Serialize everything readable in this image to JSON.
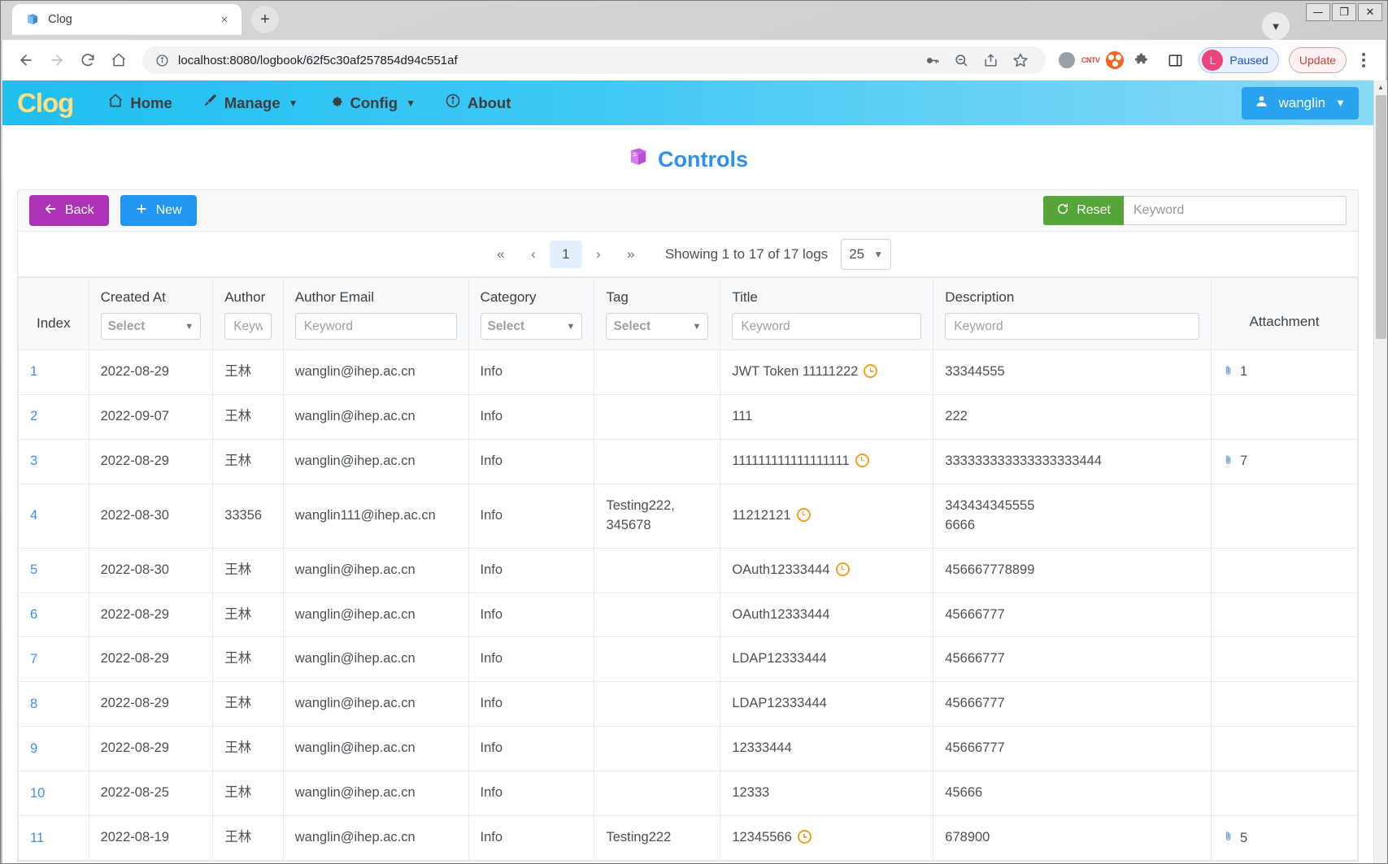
{
  "browser": {
    "tab": {
      "title": "Clog",
      "favicon_icon": "book-icon",
      "close_icon": "×"
    },
    "new_tab_label": "+",
    "tabstrip_caret_icon": "chevron-down-icon",
    "window_controls": {
      "minimize": "—",
      "maximize": "❐",
      "close": "✕"
    },
    "nav": {
      "back_icon": "arrow-left-icon",
      "forward_icon": "arrow-right-icon",
      "reload_icon": "reload-icon",
      "home_icon": "home-icon"
    },
    "omnibox": {
      "info_icon": "info-circle-icon",
      "url": "localhost:8080/logbook/62f5c30af257854d94c551af",
      "actions": [
        "key-icon",
        "zoom-out-icon",
        "share-icon",
        "star-icon"
      ]
    },
    "extensions": [
      "grey-balloon-icon",
      "cntv-icon",
      "orange-ubuntu-icon",
      "puzzle-icon",
      "sidepanel-icon"
    ],
    "profile": {
      "initial": "L",
      "label": "Paused"
    },
    "update_label": "Update",
    "menu_icon": "kebab-menu-icon"
  },
  "app": {
    "brand": "Clog",
    "nav_items": [
      {
        "label": "Home",
        "icon": "home-icon",
        "caret": false
      },
      {
        "label": "Manage",
        "icon": "brush-icon",
        "caret": true
      },
      {
        "label": "Config",
        "icon": "gear-icon",
        "caret": true
      },
      {
        "label": "About",
        "icon": "info-icon",
        "caret": false
      }
    ],
    "user": {
      "name": "wanglin",
      "icon": "user-icon",
      "caret_icon": "chevron-down-icon"
    },
    "page_title": {
      "text": "Controls",
      "icon": "book-icon"
    }
  },
  "toolbar": {
    "back_label": "Back",
    "back_icon": "arrow-left-icon",
    "new_label": "New",
    "new_icon": "plus-icon",
    "reset_label": "Reset",
    "reset_icon": "refresh-icon",
    "keyword_placeholder": "Keyword",
    "keyword_value": ""
  },
  "pager": {
    "first_label": "«",
    "prev_label": "‹",
    "pages": [
      "1"
    ],
    "current_page": "1",
    "next_label": "›",
    "last_label": "»",
    "info": "Showing 1 to 17 of 17 logs",
    "per_page": "25",
    "per_page_caret": "chevron-down-icon"
  },
  "table": {
    "columns": [
      {
        "key": "index",
        "label": "Index",
        "filter": null
      },
      {
        "key": "created_at",
        "label": "Created At",
        "filter": {
          "type": "select",
          "placeholder": "Select"
        }
      },
      {
        "key": "author",
        "label": "Author",
        "filter": {
          "type": "input",
          "placeholder": "Keyword"
        }
      },
      {
        "key": "author_email",
        "label": "Author Email",
        "filter": {
          "type": "input",
          "placeholder": "Keyword"
        }
      },
      {
        "key": "category",
        "label": "Category",
        "filter": {
          "type": "select",
          "placeholder": "Select"
        }
      },
      {
        "key": "tag",
        "label": "Tag",
        "filter": {
          "type": "select",
          "placeholder": "Select"
        }
      },
      {
        "key": "title",
        "label": "Title",
        "filter": {
          "type": "input",
          "placeholder": "Keyword"
        }
      },
      {
        "key": "description",
        "label": "Description",
        "filter": {
          "type": "input",
          "placeholder": "Keyword"
        }
      },
      {
        "key": "attachment",
        "label": "Attachment",
        "filter": null
      }
    ],
    "rows": [
      {
        "index": "1",
        "created_at": "2022-08-29",
        "author": "王林",
        "author_email": "wanglin@ihep.ac.cn",
        "category": "Info",
        "tag": "",
        "title": "JWT Token 11111222",
        "title_clock": true,
        "description": "33344555",
        "attachment": "1"
      },
      {
        "index": "2",
        "created_at": "2022-09-07",
        "author": "王林",
        "author_email": "wanglin@ihep.ac.cn",
        "category": "Info",
        "tag": "",
        "title": "111",
        "title_clock": false,
        "description": "222",
        "attachment": ""
      },
      {
        "index": "3",
        "created_at": "2022-08-29",
        "author": "王林",
        "author_email": "wanglin@ihep.ac.cn",
        "category": "Info",
        "tag": "",
        "title": "111111111111111111",
        "title_clock": true,
        "description": "333333333333333333444",
        "attachment": "7"
      },
      {
        "index": "4",
        "created_at": "2022-08-30",
        "author": "33356",
        "author_email": "wanglin111@ihep.ac.cn",
        "category": "Info",
        "tag": "Testing222, 345678",
        "title": "11212121",
        "title_clock": true,
        "description": "343434345555\n6666",
        "attachment": ""
      },
      {
        "index": "5",
        "created_at": "2022-08-30",
        "author": "王林",
        "author_email": "wanglin@ihep.ac.cn",
        "category": "Info",
        "tag": "",
        "title": "OAuth12333444",
        "title_clock": true,
        "description": "456667778899",
        "attachment": ""
      },
      {
        "index": "6",
        "created_at": "2022-08-29",
        "author": "王林",
        "author_email": "wanglin@ihep.ac.cn",
        "category": "Info",
        "tag": "",
        "title": "OAuth12333444",
        "title_clock": false,
        "description": "45666777",
        "attachment": ""
      },
      {
        "index": "7",
        "created_at": "2022-08-29",
        "author": "王林",
        "author_email": "wanglin@ihep.ac.cn",
        "category": "Info",
        "tag": "",
        "title": "LDAP12333444",
        "title_clock": false,
        "description": "45666777",
        "attachment": ""
      },
      {
        "index": "8",
        "created_at": "2022-08-29",
        "author": "王林",
        "author_email": "wanglin@ihep.ac.cn",
        "category": "Info",
        "tag": "",
        "title": "LDAP12333444",
        "title_clock": false,
        "description": "45666777",
        "attachment": ""
      },
      {
        "index": "9",
        "created_at": "2022-08-29",
        "author": "王林",
        "author_email": "wanglin@ihep.ac.cn",
        "category": "Info",
        "tag": "",
        "title": "12333444",
        "title_clock": false,
        "description": "45666777",
        "attachment": ""
      },
      {
        "index": "10",
        "created_at": "2022-08-25",
        "author": "王林",
        "author_email": "wanglin@ihep.ac.cn",
        "category": "Info",
        "tag": "",
        "title": "12333",
        "title_clock": false,
        "description": "45666",
        "attachment": ""
      },
      {
        "index": "11",
        "created_at": "2022-08-19",
        "author": "王林",
        "author_email": "wanglin@ihep.ac.cn",
        "category": "Info",
        "tag": "Testing222",
        "title": "12345566",
        "title_clock": true,
        "description": "678900",
        "attachment": "5"
      }
    ]
  },
  "colors": {
    "navbar_start": "#20bff0",
    "brand_yellow": "#ffe082",
    "title_blue": "#2e90ef",
    "back_purple": "#ad32b8",
    "new_blue": "#2196f3",
    "reset_green": "#55a538",
    "clock_orange": "#f0a020",
    "link_blue": "#3e8ef7"
  }
}
